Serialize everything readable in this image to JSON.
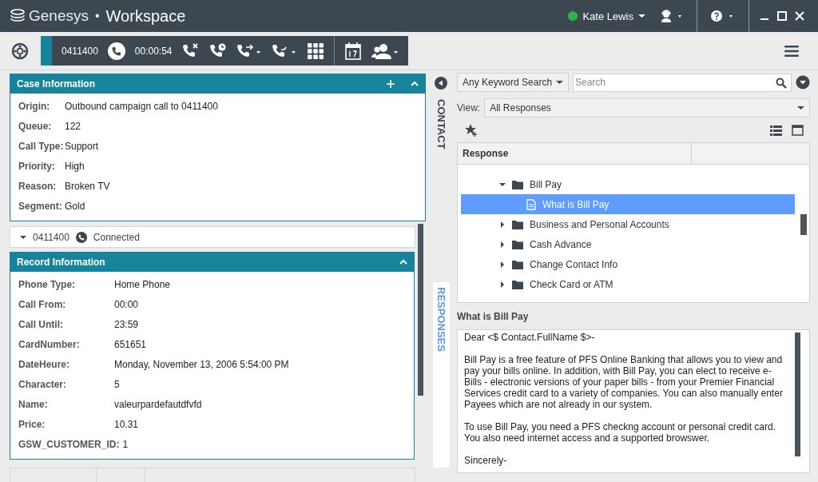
{
  "app": {
    "brand": "Genesys",
    "separator": "•",
    "title": "Workspace"
  },
  "user": {
    "name": "Kate Lewis",
    "available": true
  },
  "call": {
    "number": "0411400",
    "timer": "00:00:54"
  },
  "case_info": {
    "title": "Case Information",
    "fields": [
      {
        "label": "Origin:",
        "value": "Outbound campaign call to 0411400"
      },
      {
        "label": "Queue:",
        "value": "122"
      },
      {
        "label": "Call Type:",
        "value": "Support"
      },
      {
        "label": "Priority:",
        "value": "High"
      },
      {
        "label": "Reason:",
        "value": "Broken TV"
      },
      {
        "label": "Segment:",
        "value": "Gold"
      }
    ]
  },
  "interaction": {
    "number": "0411400",
    "status": "Connected"
  },
  "record_info": {
    "title": "Record Information",
    "fields": [
      {
        "label": "Phone Type:",
        "value": "Home Phone"
      },
      {
        "label": "Call From:",
        "value": "00:00"
      },
      {
        "label": "Call Until:",
        "value": "23:59"
      },
      {
        "label": "CardNumber:",
        "value": "651651"
      },
      {
        "label": "DateHeure:",
        "value": "Monday, November 13, 2006 5:54:00 PM"
      },
      {
        "label": "Character:",
        "value": "5"
      },
      {
        "label": "Name:",
        "value": "valeurpardefautdfvfd"
      },
      {
        "label": "Price:",
        "value": "10.31"
      },
      {
        "label": "GSW_CUSTOMER_ID:",
        "value": "1"
      }
    ]
  },
  "side_tabs": [
    {
      "label": "CONTACT",
      "selected": false
    },
    {
      "label": "RESPONSES",
      "selected": true
    }
  ],
  "responses": {
    "search_mode": "Any Keyword Search",
    "search": {
      "placeholder": "Search"
    },
    "view_label": "View:",
    "view": "All Responses",
    "column": "Response",
    "tree": [
      {
        "label": "Bill Pay",
        "kind": "folder",
        "expanded": true,
        "selected": false,
        "children": [
          {
            "label": "What is Bill Pay",
            "kind": "response",
            "selected": true
          }
        ]
      },
      {
        "label": "Business and Personal Accounts",
        "kind": "folder",
        "expanded": false,
        "selected": false
      },
      {
        "label": "Cash Advance",
        "kind": "folder",
        "expanded": false,
        "selected": false
      },
      {
        "label": "Change Contact Info",
        "kind": "folder",
        "expanded": false,
        "selected": false
      },
      {
        "label": "Check Card or ATM",
        "kind": "folder",
        "expanded": false,
        "selected": false
      }
    ],
    "preview_title": "What is Bill Pay",
    "preview_paragraphs": [
      "Dear <$ Contact.FullName $>-",
      "Bill Pay is a free feature of PFS Online Banking that allows you to view and pay your bills online. In addition, with Bill Pay, you can elect to receive e-Bills - electronic versions of your paper bills - from your Premier Financial Services credit card to a variety of companies. You can also manually enter Payees which are not already in our system.",
      "To use Bill Pay, you need a PFS checkng account or personal credit card. You also need internet access and a supported browswer.",
      "Sincerely-"
    ]
  }
}
